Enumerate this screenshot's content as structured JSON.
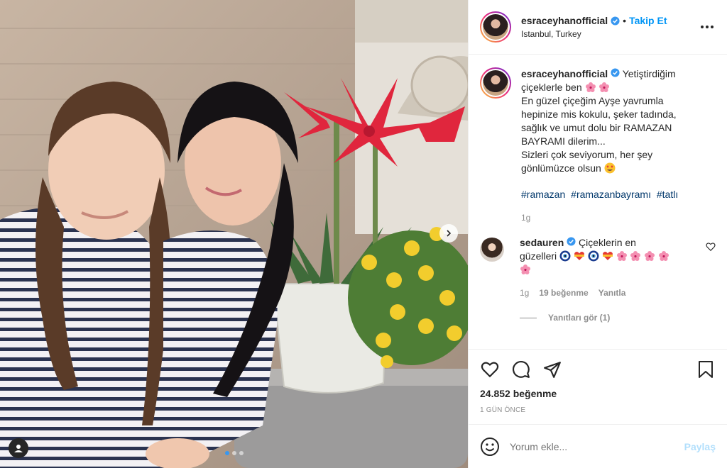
{
  "post": {
    "username": "esraceyhanofficial",
    "separator": "•",
    "follow_label": "Takip Et",
    "location": "Istanbul, Turkey",
    "caption_lines": [
      "Yetiştirdiğim",
      "çiçeklerle ben",
      "En güzel çiçeğim Ayşe yavrumla",
      "hepinize mis kokulu, şeker tadında,",
      "sağlık ve umut dolu bir RAMAZAN",
      "BAYRAMI dilerim...",
      "Sizleri çok seviyorum, her şey",
      "gönlümüzce olsun"
    ],
    "hashtags": [
      "#ramazan",
      "#ramazanbayramı",
      "#tatlı"
    ],
    "caption_time": "1g",
    "likes": "24.852 beğenme",
    "date": "1 GÜN ÖNCE"
  },
  "comment": {
    "username": "sedauren",
    "text_line1": "Çiçeklerin en",
    "text_line2": "güzelleri",
    "time": "1g",
    "likes": "19 beğenme",
    "reply_label": "Yanıtla",
    "view_replies": "Yanıtları gör (1)"
  },
  "add_comment": {
    "placeholder": "Yorum ekle...",
    "post_label": "Paylaş"
  },
  "carousel": {
    "slides": 3,
    "active": 0
  },
  "icons": {
    "header_more": "more-dots-icon",
    "verified": "verified-badge-icon",
    "like": "heart-icon",
    "comment": "comment-icon",
    "share": "share-icon",
    "save": "bookmark-icon",
    "emoji": "smiley-icon",
    "next": "chevron-right-icon",
    "user_tag": "user-tag-icon"
  },
  "colors": {
    "accent": "#0095f6",
    "verified": "#3897f0",
    "muted": "#8e8e8e",
    "hashtag": "#00376b"
  }
}
